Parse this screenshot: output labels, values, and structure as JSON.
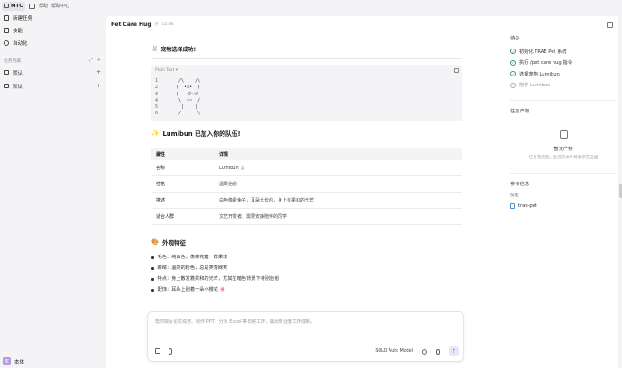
{
  "topbar": {
    "app_name": "MTC",
    "menu": [
      "帮助",
      "帮助中心"
    ]
  },
  "sidebar": {
    "items": [
      {
        "label": "新建任务",
        "icon": "compose-icon"
      },
      {
        "label": "技能",
        "icon": "skill-icon"
      },
      {
        "label": "自动化",
        "icon": "automation-icon"
      }
    ],
    "section_title": "任务列表",
    "folders": [
      {
        "label": "默认"
      },
      {
        "label": "默认"
      }
    ],
    "user": {
      "initial": "本",
      "name": "本体"
    }
  },
  "main": {
    "title": "Pet Care Hug",
    "subtitle": "15:36",
    "success_heading": "宠物选择成功!",
    "code": {
      "lang": "Plain Text",
      "lines": [
        {
          "n": "1",
          "t": "    /\\    /\\"
        },
        {
          "n": "2",
          "t": "   (  •ᴥ•  )"
        },
        {
          "n": "3",
          "t": "   (   づ♡づ"
        },
        {
          "n": "4",
          "t": "    \\  ~~  /"
        },
        {
          "n": "5",
          "t": "     |    |"
        },
        {
          "n": "6",
          "t": "    /      \\"
        }
      ]
    },
    "joined_heading": "Lumibun 已加入你的队伍!",
    "table": {
      "headers": [
        "属性",
        "详情"
      ],
      "rows": [
        [
          "名称",
          "Lumibun 🐰"
        ],
        [
          "性格",
          "温柔治愈"
        ],
        [
          "描述",
          "白色像素兔子，耳朵长长的，身上有柔和的光芒"
        ],
        [
          "适合人群",
          "文艺开发者、需要安静陪伴的同学"
        ]
      ]
    },
    "appearance_heading": "外观特征",
    "features": [
      "毛色：纯白色，像棉花糖一样柔软",
      "眼睛：温柔的粉色，总是笑着眯笑",
      "特点：身上散发着柔和的光芒，尤其在暗色背景下特别治愈",
      "配饰：耳朵上别着一朵小樱花 🌸"
    ]
  },
  "input": {
    "placeholder": "帮你撰写论文综述、制作 PPT、分析 Excel 等日常工作，输出专业度工作成果。",
    "model": "SOLO Auto Model"
  },
  "rightpanel": {
    "todo_title": "待办",
    "todos": [
      {
        "label": "初始化 TRAE Pet 系统",
        "done": true
      },
      {
        "label": "执行 /pet care hug 指令",
        "done": true
      },
      {
        "label": "选择宠物 Lumibun",
        "done": true
      },
      {
        "label": "陪伴 Lumibun",
        "done": false
      }
    ],
    "artifact_title": "任务产物",
    "empty_title": "暂无产物",
    "empty_sub": "任务完成后，生成的文件将展示在这里",
    "ref_title": "参考信息",
    "ref_label": "技能",
    "ref_item": "trae-pet"
  }
}
